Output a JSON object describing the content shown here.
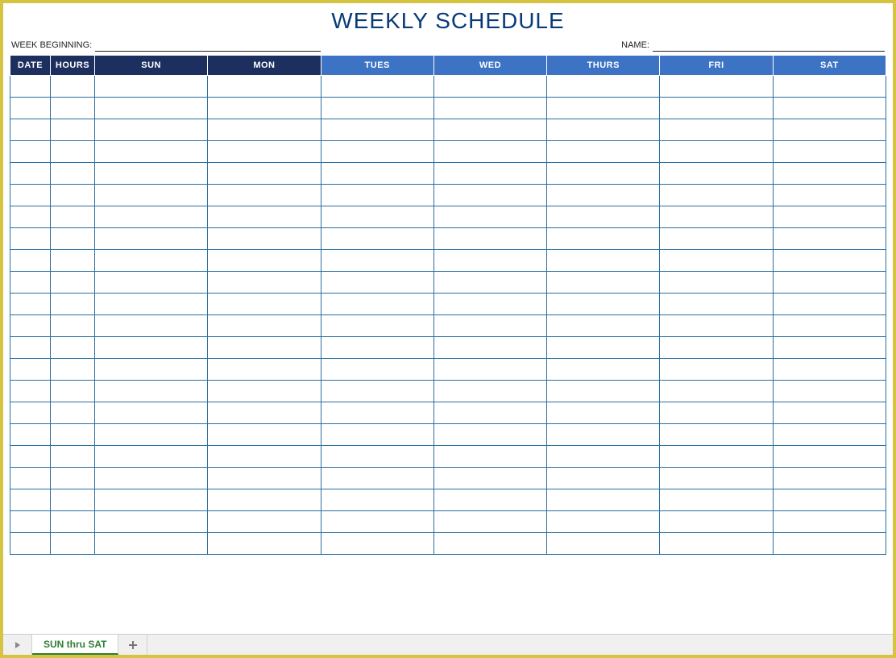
{
  "title": "WEEKLY SCHEDULE",
  "meta": {
    "week_beginning_label": "WEEK BEGINNING:",
    "week_beginning_value": "",
    "name_label": "NAME:",
    "name_value": ""
  },
  "columns": {
    "date": "DATE",
    "hours": "HOURS",
    "days": [
      "SUN",
      "MON",
      "TUES",
      "WED",
      "THURS",
      "FRI",
      "SAT"
    ]
  },
  "row_count": 22,
  "watermark": "",
  "tabs": {
    "active": "SUN thru SAT"
  }
}
